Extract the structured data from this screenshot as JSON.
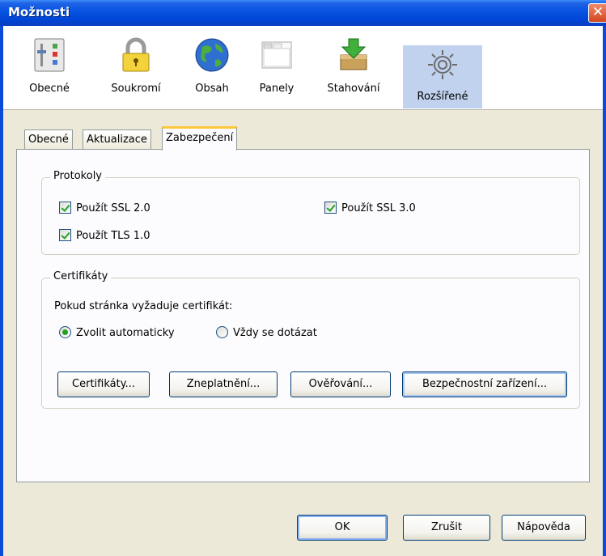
{
  "window": {
    "title": "Možnosti",
    "close_glyph": "✕"
  },
  "toolbar": {
    "items": [
      {
        "label": "Obecné",
        "icon": "general-icon"
      },
      {
        "label": "Soukromí",
        "icon": "lock-icon"
      },
      {
        "label": "Obsah",
        "icon": "globe-icon"
      },
      {
        "label": "Panely",
        "icon": "tabs-window-icon"
      },
      {
        "label": "Stahování",
        "icon": "download-icon"
      },
      {
        "label": "Rozšířené",
        "icon": "gear-icon",
        "selected": true
      }
    ]
  },
  "tabs": [
    {
      "label": "Obecné"
    },
    {
      "label": "Aktualizace"
    },
    {
      "label": "Zabezpečení",
      "active": true
    }
  ],
  "protocols": {
    "legend": "Protokoly",
    "ssl2": {
      "label": "Použít SSL 2.0",
      "checked": true
    },
    "ssl3": {
      "label": "Použít SSL 3.0",
      "checked": true
    },
    "tls1": {
      "label": "Použít TLS 1.0",
      "checked": true
    }
  },
  "certificates": {
    "legend": "Certifikáty",
    "prompt": "Pokud stránka vyžaduje certifikát:",
    "option_auto": {
      "label": "Zvolit automaticky",
      "selected": true
    },
    "option_ask": {
      "label": "Vždy se dotázat",
      "selected": false
    },
    "buttons": {
      "certificates": "Certifikáty...",
      "revocation": "Zneplatnění...",
      "verification": "Ověřování...",
      "security_devices": "Bezpečnostní zařízení..."
    }
  },
  "footer": {
    "ok": "OK",
    "cancel": "Zrušit",
    "help": "Nápověda"
  },
  "colors": {
    "titlebar": "#0a55e3",
    "selected_toolbar": "#c1d2ee",
    "active_tab_accent": "#ffc83c",
    "checkmark": "#21a121"
  }
}
